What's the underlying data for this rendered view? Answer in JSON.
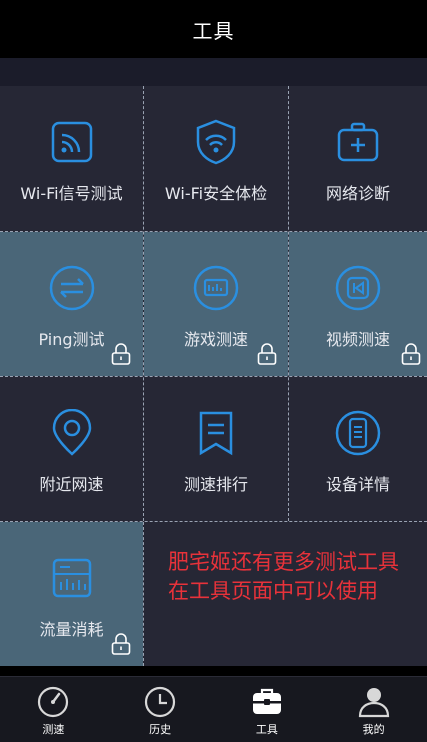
{
  "header": {
    "title": "工具"
  },
  "tools": [
    {
      "label": "Wi-Fi信号测试",
      "icon": "wifi-signal-icon",
      "locked": false
    },
    {
      "label": "Wi-Fi安全体检",
      "icon": "wifi-shield-icon",
      "locked": false
    },
    {
      "label": "网络诊断",
      "icon": "medical-kit-icon",
      "locked": false
    },
    {
      "label": "Ping测试",
      "icon": "ping-arrows-icon",
      "locked": true
    },
    {
      "label": "游戏测速",
      "icon": "game-speed-icon",
      "locked": true
    },
    {
      "label": "视频测速",
      "icon": "video-icon",
      "locked": true
    },
    {
      "label": "附近网速",
      "icon": "location-pin-icon",
      "locked": false
    },
    {
      "label": "测速排行",
      "icon": "ranking-bookmark-icon",
      "locked": false
    },
    {
      "label": "设备详情",
      "icon": "device-phone-icon",
      "locked": false
    },
    {
      "label": "流量消耗",
      "icon": "data-usage-icon",
      "locked": true
    }
  ],
  "promo": {
    "line1": "肥宅姬还有更多测试工具",
    "line2": "在工具页面中可以使用"
  },
  "tabbar": {
    "items": [
      {
        "label": "测速",
        "icon": "speedometer-icon",
        "active": false
      },
      {
        "label": "历史",
        "icon": "clock-icon",
        "active": false
      },
      {
        "label": "工具",
        "icon": "toolbox-icon",
        "active": true
      },
      {
        "label": "我的",
        "icon": "user-icon",
        "active": false
      }
    ]
  },
  "colors": {
    "accent": "#2a8fe0",
    "locked_bg": "#4a6678",
    "cell_bg": "#262735",
    "promo": "#e8323a"
  }
}
